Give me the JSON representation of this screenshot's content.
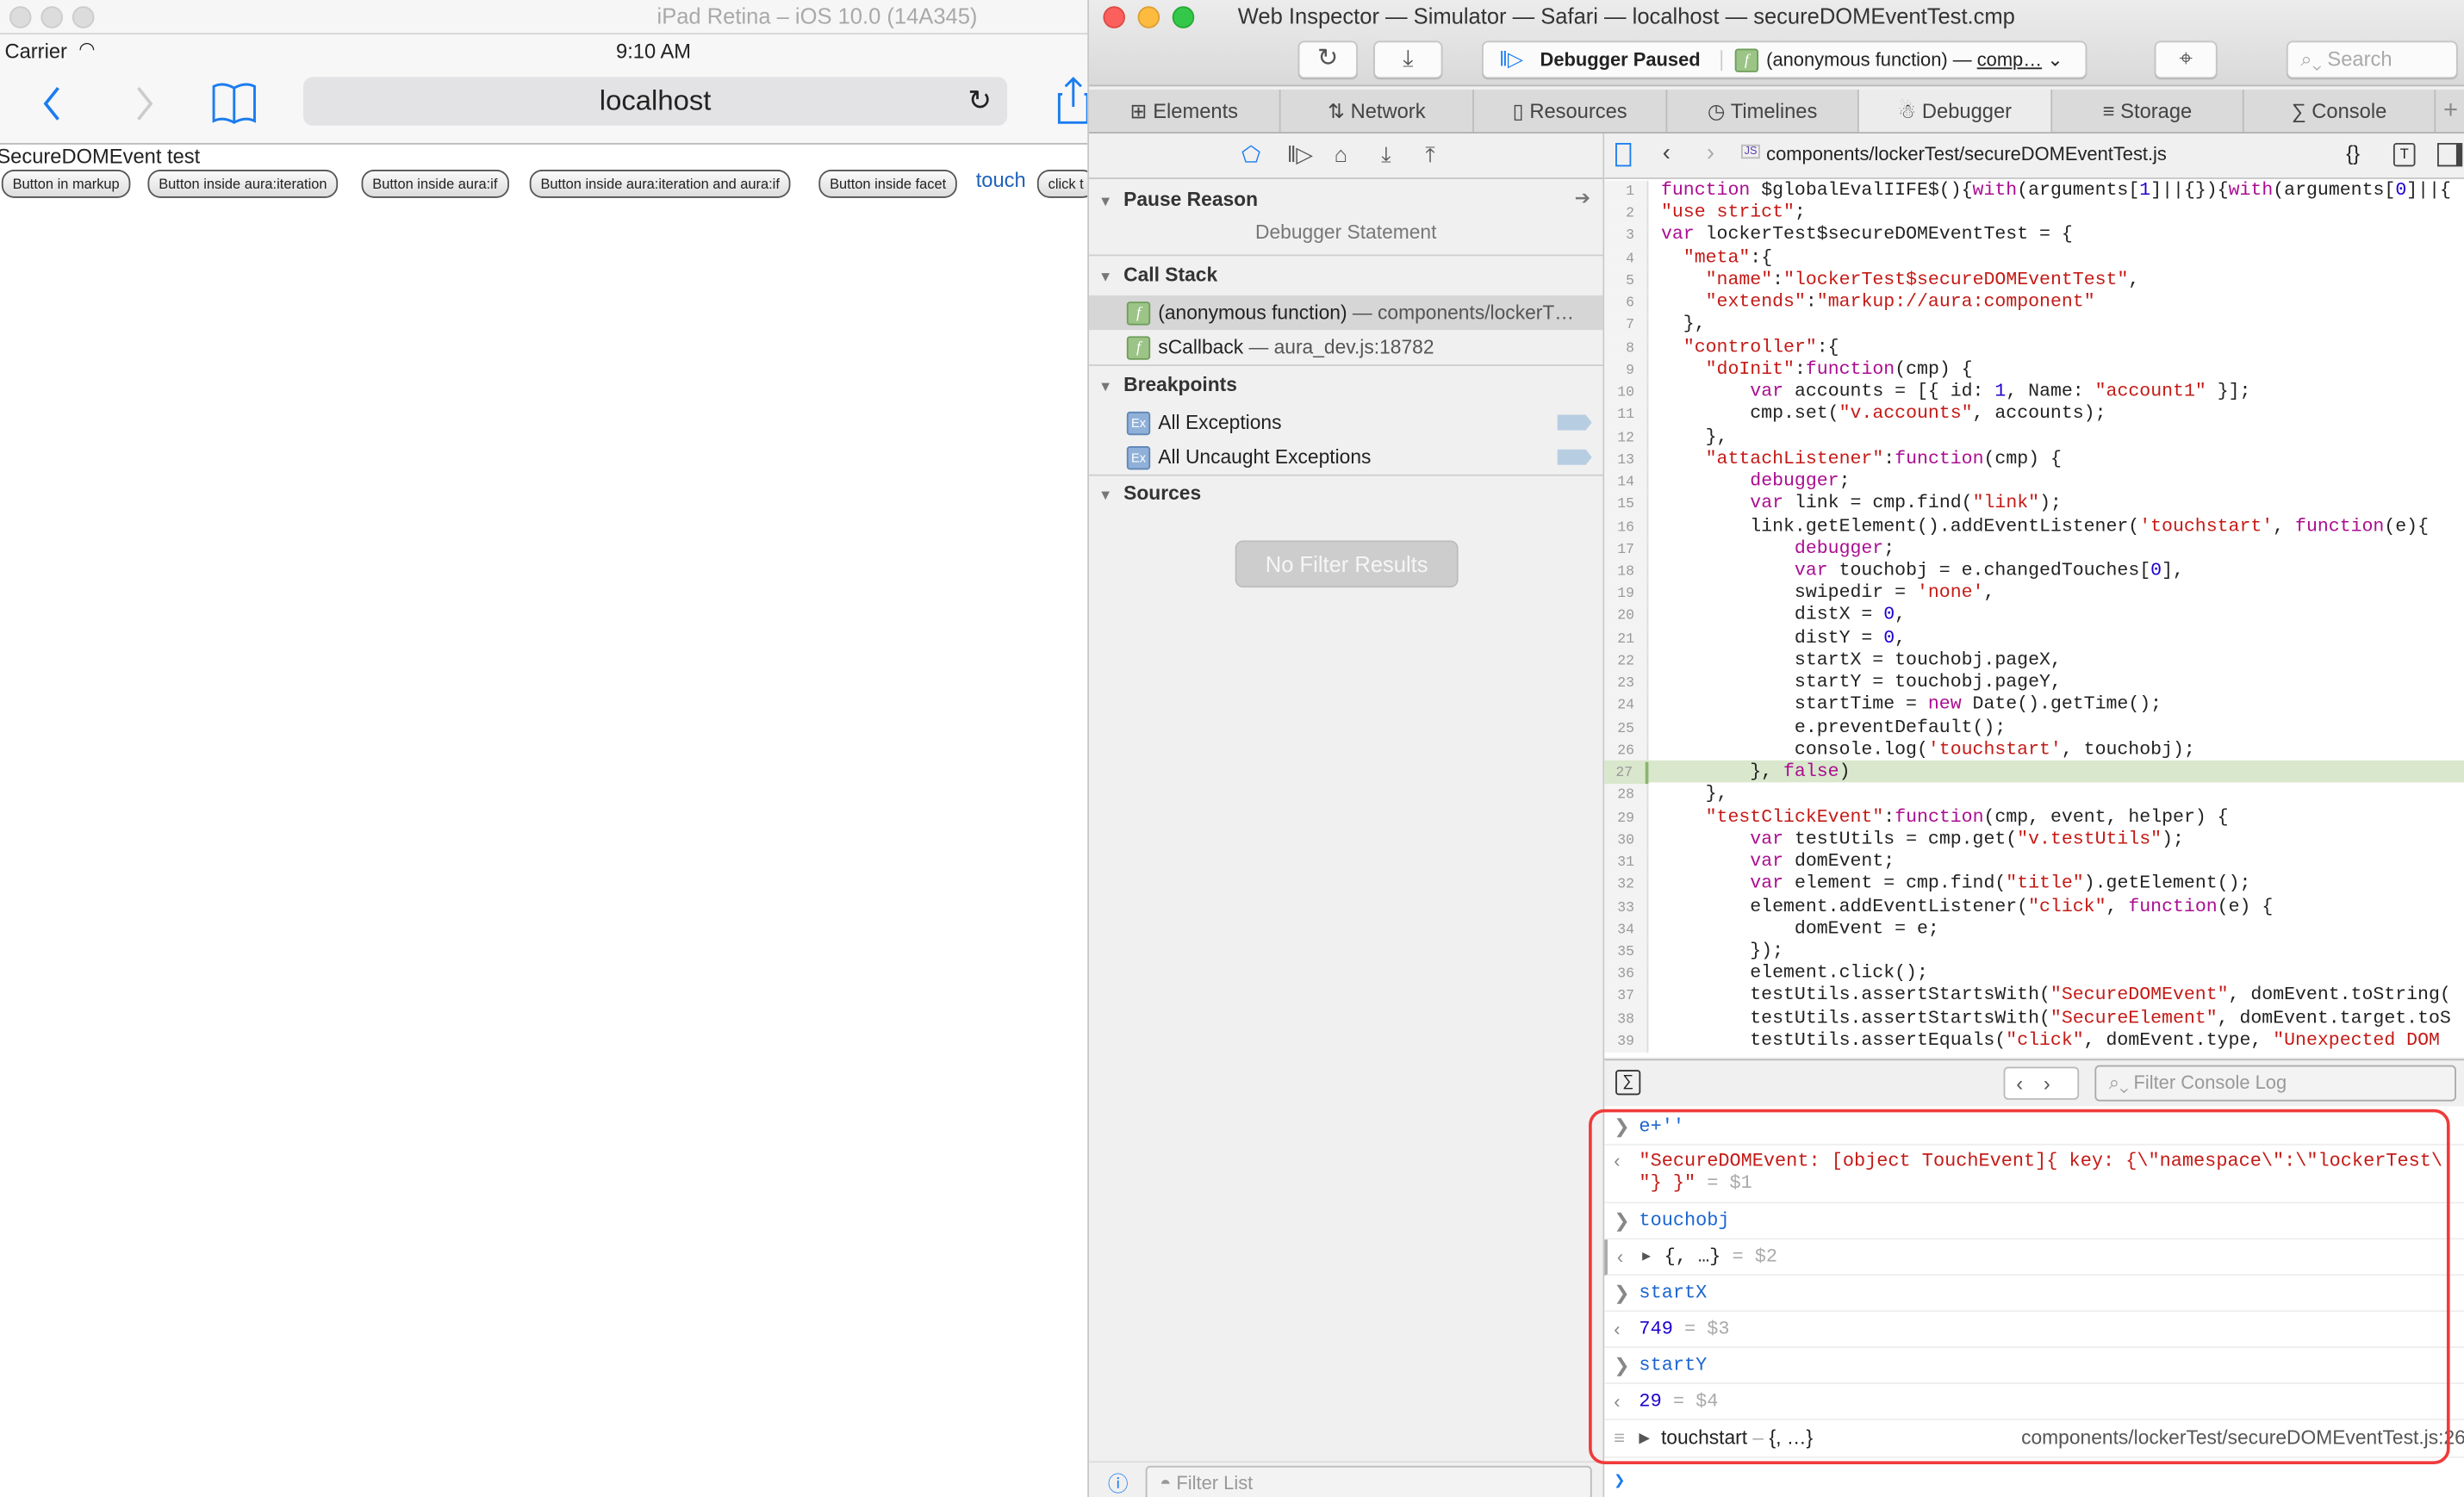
{
  "simulator": {
    "window_title": "iPad Retina – iOS 10.0 (14A345)",
    "carrier": "Carrier",
    "time": "9:10 AM",
    "url": "localhost",
    "page_title": "SecureDOMEvent test",
    "buttons": [
      "Button in markup",
      "Button inside aura:iteration",
      "Button inside aura:if",
      "Button inside aura:iteration and aura:if",
      "Button inside facet"
    ],
    "touch_link": "touch",
    "partial_button": "click t"
  },
  "inspector": {
    "window_title": "Web Inspector — Simulator — Safari — localhost — secureDOMEventTest.cmp",
    "status_label": "Debugger Paused",
    "status_function": "(anonymous function) — ",
    "status_location": "comp…",
    "search_placeholder": "Search",
    "tabs": [
      {
        "label": "Elements",
        "icon": "elements-icon"
      },
      {
        "label": "Network",
        "icon": "network-icon"
      },
      {
        "label": "Resources",
        "icon": "resources-icon"
      },
      {
        "label": "Timelines",
        "icon": "timelines-icon"
      },
      {
        "label": "Debugger",
        "icon": "bug-icon",
        "selected": true
      },
      {
        "label": "Storage",
        "icon": "storage-icon"
      },
      {
        "label": "Console",
        "icon": "console-icon"
      }
    ],
    "sidebar": {
      "pause_reason_title": "Pause Reason",
      "pause_reason": "Debugger Statement",
      "call_stack_title": "Call Stack",
      "call_stack": [
        {
          "name": "(anonymous function)",
          "location": " — components/lockerT…",
          "selected": true
        },
        {
          "name": "sCallback",
          "location": " — aura_dev.js:18782"
        }
      ],
      "breakpoints_title": "Breakpoints",
      "breakpoints": [
        "All Exceptions",
        "All Uncaught Exceptions"
      ],
      "sources_title": "Sources",
      "no_results": "No Filter Results",
      "filter_placeholder": "Filter List"
    },
    "editor": {
      "file_path": "components/lockerTest/secureDOMEventTest.js",
      "file_icon": "JS",
      "current_line": 27,
      "lines": [
        [
          [
            "k",
            "function"
          ],
          [
            "p",
            " $globalEvalIIFE$(){"
          ],
          [
            "k",
            "with"
          ],
          [
            "p",
            "(arguments["
          ],
          [
            "n",
            "1"
          ],
          [
            "p",
            "]||{}){"
          ],
          [
            "k",
            "with"
          ],
          [
            "p",
            "(arguments["
          ],
          [
            "n",
            "0"
          ],
          [
            "p",
            "]||{"
          ]
        ],
        [
          [
            "s",
            "\"use strict\""
          ],
          [
            "p",
            ";"
          ]
        ],
        [
          [
            "k",
            "var"
          ],
          [
            "p",
            " lockerTest$secureDOMEventTest = {"
          ]
        ],
        [
          [
            "p",
            "  "
          ],
          [
            "s",
            "\"meta\""
          ],
          [
            "p",
            ":{"
          ]
        ],
        [
          [
            "p",
            "    "
          ],
          [
            "s",
            "\"name\""
          ],
          [
            "p",
            ":"
          ],
          [
            "s",
            "\"lockerTest$secureDOMEventTest\""
          ],
          [
            "p",
            ","
          ]
        ],
        [
          [
            "p",
            "    "
          ],
          [
            "s",
            "\"extends\""
          ],
          [
            "p",
            ":"
          ],
          [
            "s",
            "\"markup://aura:component\""
          ]
        ],
        [
          [
            "p",
            "  },"
          ]
        ],
        [
          [
            "p",
            "  "
          ],
          [
            "s",
            "\"controller\""
          ],
          [
            "p",
            ":{"
          ]
        ],
        [
          [
            "p",
            "    "
          ],
          [
            "s",
            "\"doInit\""
          ],
          [
            "p",
            ":"
          ],
          [
            "k",
            "function"
          ],
          [
            "p",
            "(cmp) {"
          ]
        ],
        [
          [
            "p",
            "        "
          ],
          [
            "k",
            "var"
          ],
          [
            "p",
            " accounts = [{ id: "
          ],
          [
            "n",
            "1"
          ],
          [
            "p",
            ", Name: "
          ],
          [
            "s",
            "\"account1\""
          ],
          [
            "p",
            " }];"
          ]
        ],
        [
          [
            "p",
            "        cmp.set("
          ],
          [
            "s",
            "\"v.accounts\""
          ],
          [
            "p",
            ", accounts);"
          ]
        ],
        [
          [
            "p",
            "    },"
          ]
        ],
        [
          [
            "p",
            "    "
          ],
          [
            "s",
            "\"attachListener\""
          ],
          [
            "p",
            ":"
          ],
          [
            "k",
            "function"
          ],
          [
            "p",
            "(cmp) {"
          ]
        ],
        [
          [
            "p",
            "        "
          ],
          [
            "k",
            "debugger"
          ],
          [
            "p",
            ";"
          ]
        ],
        [
          [
            "p",
            "        "
          ],
          [
            "k",
            "var"
          ],
          [
            "p",
            " link = cmp.find("
          ],
          [
            "s",
            "\"link\""
          ],
          [
            "p",
            ");"
          ]
        ],
        [
          [
            "p",
            "        link.getElement().addEventListener("
          ],
          [
            "s",
            "'touchstart'"
          ],
          [
            "p",
            ", "
          ],
          [
            "k",
            "function"
          ],
          [
            "p",
            "(e){"
          ]
        ],
        [
          [
            "p",
            "            "
          ],
          [
            "k",
            "debugger"
          ],
          [
            "p",
            ";"
          ]
        ],
        [
          [
            "p",
            "            "
          ],
          [
            "k",
            "var"
          ],
          [
            "p",
            " touchobj = e.changedTouches["
          ],
          [
            "n",
            "0"
          ],
          [
            "p",
            "],"
          ]
        ],
        [
          [
            "p",
            "            swipedir = "
          ],
          [
            "s",
            "'none'"
          ],
          [
            "p",
            ","
          ]
        ],
        [
          [
            "p",
            "            distX = "
          ],
          [
            "n",
            "0"
          ],
          [
            "p",
            ","
          ]
        ],
        [
          [
            "p",
            "            distY = "
          ],
          [
            "n",
            "0"
          ],
          [
            "p",
            ","
          ]
        ],
        [
          [
            "p",
            "            startX = touchobj.pageX,"
          ]
        ],
        [
          [
            "p",
            "            startY = touchobj.pageY,"
          ]
        ],
        [
          [
            "p",
            "            startTime = "
          ],
          [
            "k",
            "new"
          ],
          [
            "p",
            " Date().getTime();"
          ]
        ],
        [
          [
            "p",
            "            e.preventDefault();"
          ]
        ],
        [
          [
            "p",
            "            console.log("
          ],
          [
            "s",
            "'touchstart'"
          ],
          [
            "p",
            ", touchobj);"
          ]
        ],
        [
          [
            "p",
            "        }, "
          ],
          [
            "k",
            "false"
          ],
          [
            "p",
            ")"
          ]
        ],
        [
          [
            "p",
            "    },"
          ]
        ],
        [
          [
            "p",
            "    "
          ],
          [
            "s",
            "\"testClickEvent\""
          ],
          [
            "p",
            ":"
          ],
          [
            "k",
            "function"
          ],
          [
            "p",
            "(cmp, event, helper) {"
          ]
        ],
        [
          [
            "p",
            "        "
          ],
          [
            "k",
            "var"
          ],
          [
            "p",
            " testUtils = cmp.get("
          ],
          [
            "s",
            "\"v.testUtils\""
          ],
          [
            "p",
            ");"
          ]
        ],
        [
          [
            "p",
            "        "
          ],
          [
            "k",
            "var"
          ],
          [
            "p",
            " domEvent;"
          ]
        ],
        [
          [
            "p",
            "        "
          ],
          [
            "k",
            "var"
          ],
          [
            "p",
            " element = cmp.find("
          ],
          [
            "s",
            "\"title\""
          ],
          [
            "p",
            ").getElement();"
          ]
        ],
        [
          [
            "p",
            "        element.addEventListener("
          ],
          [
            "s",
            "\"click\""
          ],
          [
            "p",
            ", "
          ],
          [
            "k",
            "function"
          ],
          [
            "p",
            "(e) {"
          ]
        ],
        [
          [
            "p",
            "            domEvent = e;"
          ]
        ],
        [
          [
            "p",
            "        });"
          ]
        ],
        [
          [
            "p",
            "        element.click();"
          ]
        ],
        [
          [
            "p",
            "        testUtils.assertStartsWith("
          ],
          [
            "s",
            "\"SecureDOMEvent\""
          ],
          [
            "p",
            ", domEvent.toString("
          ]
        ],
        [
          [
            "p",
            "        testUtils.assertStartsWith("
          ],
          [
            "s",
            "\"SecureElement\""
          ],
          [
            "p",
            ", domEvent.target.toS"
          ]
        ],
        [
          [
            "p",
            "        testUtils.assertEquals("
          ],
          [
            "s",
            "\"click\""
          ],
          [
            "p",
            ", domEvent.type, "
          ],
          [
            "s",
            "\"Unexpected DOM"
          ]
        ]
      ]
    },
    "console": {
      "filter_placeholder": "Filter Console Log",
      "entries": {
        "in1": "e+''",
        "out1_line1": "\"SecureDOMEvent: [object TouchEvent]{ key: {\\\"namespace\\\":\\\"lockerTest\\",
        "out1_line2": "\"} }\"",
        "out1_var": " = $1",
        "in2": "touchobj",
        "out2": "{, …}",
        "out2_var": " = $2",
        "in3": "startX",
        "out3": "749",
        "out3_var": " = $3",
        "in4": "startY",
        "out4": "29",
        "out4_var": " = $4",
        "log_label": "touchstart",
        "log_dash": " – ",
        "log_obj": "{, …}",
        "log_source": "components/lockerTest/secureDOMEventTest.js:26"
      }
    }
  },
  "colors": {
    "keyword": "#aa0d91",
    "string": "#c41a16",
    "number": "#1c00cf",
    "accent": "#1b7cf0",
    "highlight_box": "#f03a3a",
    "current_line": "#d9e7cd"
  }
}
